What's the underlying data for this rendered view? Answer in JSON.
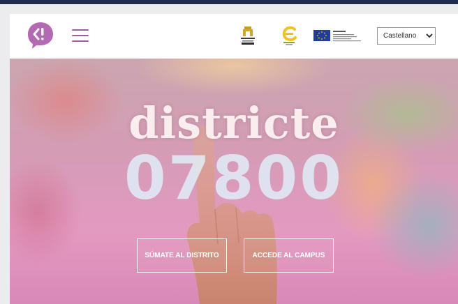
{
  "window": {
    "topbar_color": "#1f2c4a"
  },
  "header": {
    "logo_icon": "speech-bubble-logo-icon",
    "menu_icon": "hamburger-menu-icon",
    "accent_color": "#a05aa0",
    "language_select": {
      "selected": "Castellano",
      "options": [
        "Castellano"
      ]
    }
  },
  "hero": {
    "title_word": "districte",
    "title_number": "07800",
    "buttons": [
      {
        "label": "SÚMATE AL DISTRITO"
      },
      {
        "label": "ACCEDE AL CAMPUS"
      }
    ]
  }
}
